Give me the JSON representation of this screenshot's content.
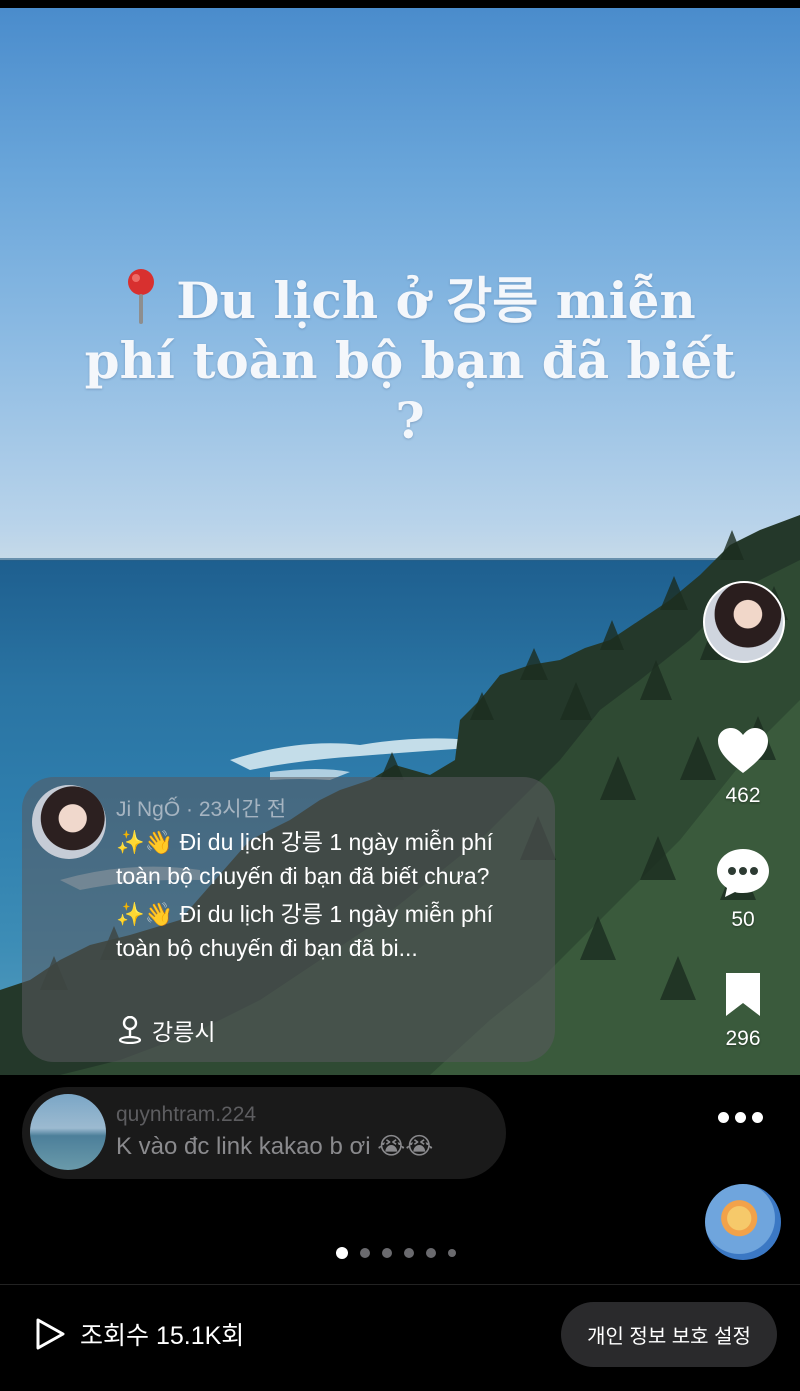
{
  "post": {
    "overlay_title": "Du lịch ở 강릉 miễn phí toàn bộ bạn đã biết ?"
  },
  "actions": {
    "likes": "462",
    "comments": "50",
    "saves": "296"
  },
  "caption": {
    "author": "Ji NgỐ",
    "separator": "·",
    "time": "23시간 전",
    "line1": "✨👋 Đi du lịch 강릉  1 ngày miễn phí toàn bộ chuyến đi bạn đã biết chưa?",
    "line2": "✨👋 Đi du lịch 강릉  1 ngày miễn phí toàn bộ chuyến đi bạn đã bi...",
    "location": "강릉시"
  },
  "top_comment": {
    "user": "quynhtram.224",
    "text": "K vào đc link kakao b ơi 😭😭"
  },
  "pager": {
    "total": 6,
    "active_index": 0
  },
  "footer": {
    "views_label": "조회수 15.1K회",
    "privacy_button": "개인 정보 보호 설정"
  },
  "icons": {
    "pin": "pin-icon",
    "like": "heart-icon",
    "comment": "comment-icon",
    "save": "bookmark-icon",
    "location": "location-pin-icon",
    "play": "play-icon",
    "more": "more-icon"
  }
}
